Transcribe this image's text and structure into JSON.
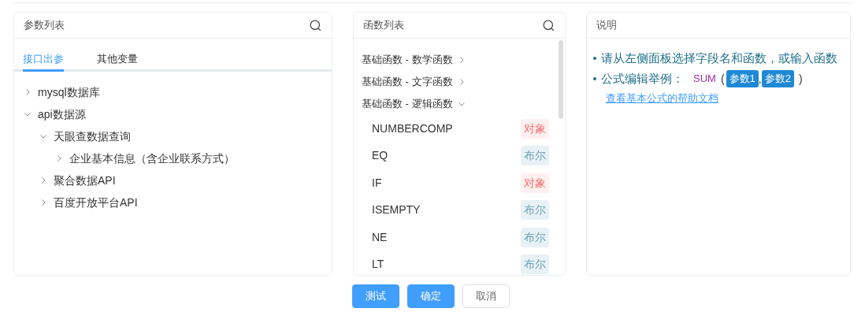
{
  "params_panel": {
    "title": "参数列表",
    "tabs": [
      {
        "label": "接口出参",
        "selected": true
      },
      {
        "label": "其他变量",
        "selected": false
      }
    ],
    "tree": [
      {
        "label": "mysql数据库",
        "expanded": false
      },
      {
        "label": "api数据源",
        "expanded": true,
        "children": [
          {
            "label": "天眼查数据查询",
            "expanded": true,
            "children": [
              {
                "label": "企业基本信息（含企业联系方式）",
                "expanded": false
              }
            ]
          },
          {
            "label": "聚合数据API",
            "expanded": false
          },
          {
            "label": "百度开放平台API",
            "expanded": false
          }
        ]
      }
    ]
  },
  "functions_panel": {
    "title": "函数列表",
    "categories": [
      {
        "label": "基础函数 - 数学函数",
        "expanded": false
      },
      {
        "label": "基础函数 - 文字函数",
        "expanded": false
      },
      {
        "label": "基础函数 - 逻辑函数",
        "expanded": true,
        "functions": [
          {
            "name": "NUMBERCOMP",
            "type": "对象",
            "kind": "object"
          },
          {
            "name": "EQ",
            "type": "布尔",
            "kind": "boolean"
          },
          {
            "name": "IF",
            "type": "对象",
            "kind": "object"
          },
          {
            "name": "ISEMPTY",
            "type": "布尔",
            "kind": "boolean"
          },
          {
            "name": "NE",
            "type": "布尔",
            "kind": "boolean"
          },
          {
            "name": "LT",
            "type": "布尔",
            "kind": "boolean"
          }
        ]
      }
    ]
  },
  "help_panel": {
    "title": "说明",
    "bullets": [
      "请从左侧面板选择字段名和函数，或输入函数"
    ],
    "example": {
      "label": "公式编辑举例：",
      "function": "SUM",
      "open_paren": "(",
      "args": [
        "参数1",
        "参数2"
      ],
      "separator": ",",
      "close_paren": ")"
    },
    "link": "查看基本公式的帮助文档"
  },
  "buttons": [
    {
      "label": "测试",
      "kind": "primary"
    },
    {
      "label": "确定",
      "kind": "primary"
    },
    {
      "label": "取消",
      "kind": "default"
    }
  ]
}
